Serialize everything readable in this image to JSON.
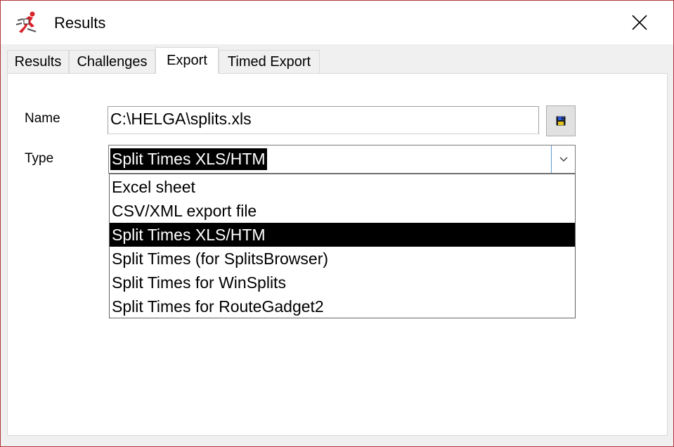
{
  "window": {
    "title": "Results",
    "icon": "orienteering-runner-icon",
    "close_icon": "close-icon",
    "border_color": "#b3353a"
  },
  "tabs": [
    {
      "label": "Results",
      "active": false
    },
    {
      "label": "Challenges",
      "active": false
    },
    {
      "label": "Export",
      "active": true
    },
    {
      "label": "Timed Export",
      "active": false
    }
  ],
  "export": {
    "name_label": "Name",
    "name_value": "C:\\HELGA\\splits.xls",
    "save_button_icon": "floppy-disk-icon",
    "type_label": "Type",
    "type_selected": "Split Times XLS/HTM",
    "type_options": [
      "Excel sheet",
      "CSV/XML export file",
      "Split Times XLS/HTM",
      "Split Times (for SplitsBrowser)",
      "Split Times for WinSplits",
      "Split Times for RouteGadget2"
    ],
    "highlight_color": "#000000"
  }
}
